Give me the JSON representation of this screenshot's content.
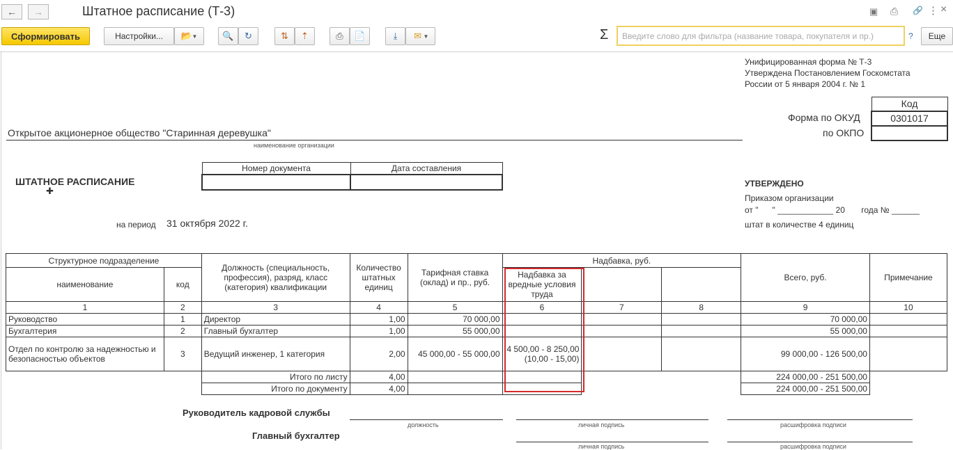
{
  "window": {
    "title": "Штатное расписание (Т-3)"
  },
  "toolbar": {
    "generate_label": "Сформировать",
    "settings_label": "Настройки...",
    "sigma": "Σ",
    "filter_placeholder": "Введите слово для фильтра (название товара, покупателя и пр.)",
    "help": "?",
    "more_label": "Еще"
  },
  "form_header": {
    "line1": "Унифицированная форма № Т-3",
    "line2": "Утверждена Постановлением Госкомстата",
    "line3": "России от 5 января 2004 г. № 1",
    "code_label": "Код",
    "okud_label": "Форма по ОКУД",
    "okud_value": "0301017",
    "okpo_label": "по ОКПО",
    "okpo_value": ""
  },
  "org": {
    "name": "Открытое акционерное общество \"Старинная деревушка\"",
    "caption": "наименование организации"
  },
  "doc": {
    "title": "ШТАТНОЕ РАСПИСАНИЕ",
    "num_header": "Номер документа",
    "date_header": "Дата составления",
    "period_label": "на период",
    "period_value": "31 октября 2022 г."
  },
  "approved": {
    "title": "УТВЕРЖДЕНО",
    "line1": "Приказом организации",
    "line2": "от \"      \" ____________ 20       года № ______",
    "line3": "штат в количестве 4 единиц"
  },
  "table": {
    "h_struct": "Структурное  подразделение",
    "h_name": "наименование",
    "h_code": "код",
    "h_position": "Должность (специальность, профессия), разряд, класс (категория) квалификации",
    "h_count": "Количество штатных единиц",
    "h_rate": "Тарифная ставка (оклад) и пр., руб.",
    "h_allow": "Надбавка, руб.",
    "h_allow6": "Надбавка за вредные условия труда",
    "h_total": "Всего, руб.",
    "h_note": "Примечание",
    "nums": [
      "1",
      "2",
      "3",
      "4",
      "5",
      "6",
      "7",
      "8",
      "9",
      "10"
    ],
    "rows": [
      {
        "name": "Руководство",
        "code": "1",
        "position": "Директор",
        "count": "1,00",
        "rate": "70 000,00",
        "allow6": "",
        "total": "70 000,00"
      },
      {
        "name": "Бухгалтерия",
        "code": "2",
        "position": "Главный бухгалтер",
        "count": "1,00",
        "rate": "55 000,00",
        "allow6": "",
        "total": "55 000,00"
      },
      {
        "name": "Отдел по контролю за надежностью и безопасностью объектов",
        "code": "3",
        "position": "Ведущий инженер, 1 категория",
        "count": "2,00",
        "rate": "45 000,00 - 55 000,00",
        "allow6": "4 500,00 - 8 250,00 (10,00 - 15,00)",
        "total": "99 000,00 - 126 500,00"
      }
    ],
    "sum_sheet_label": "Итого по листу",
    "sum_sheet_count": "4,00",
    "sum_sheet_total": "224 000,00 - 251 500,00",
    "sum_doc_label": "Итого по документу",
    "sum_doc_count": "4,00",
    "sum_doc_total": "224 000,00 - 251 500,00"
  },
  "signatures": {
    "hr_label": "Руководитель кадровой службы",
    "acc_label": "Главный бухгалтер",
    "cap_position": "должность",
    "cap_sign": "личная подпись",
    "cap_decode": "расшифровка  подписи"
  }
}
